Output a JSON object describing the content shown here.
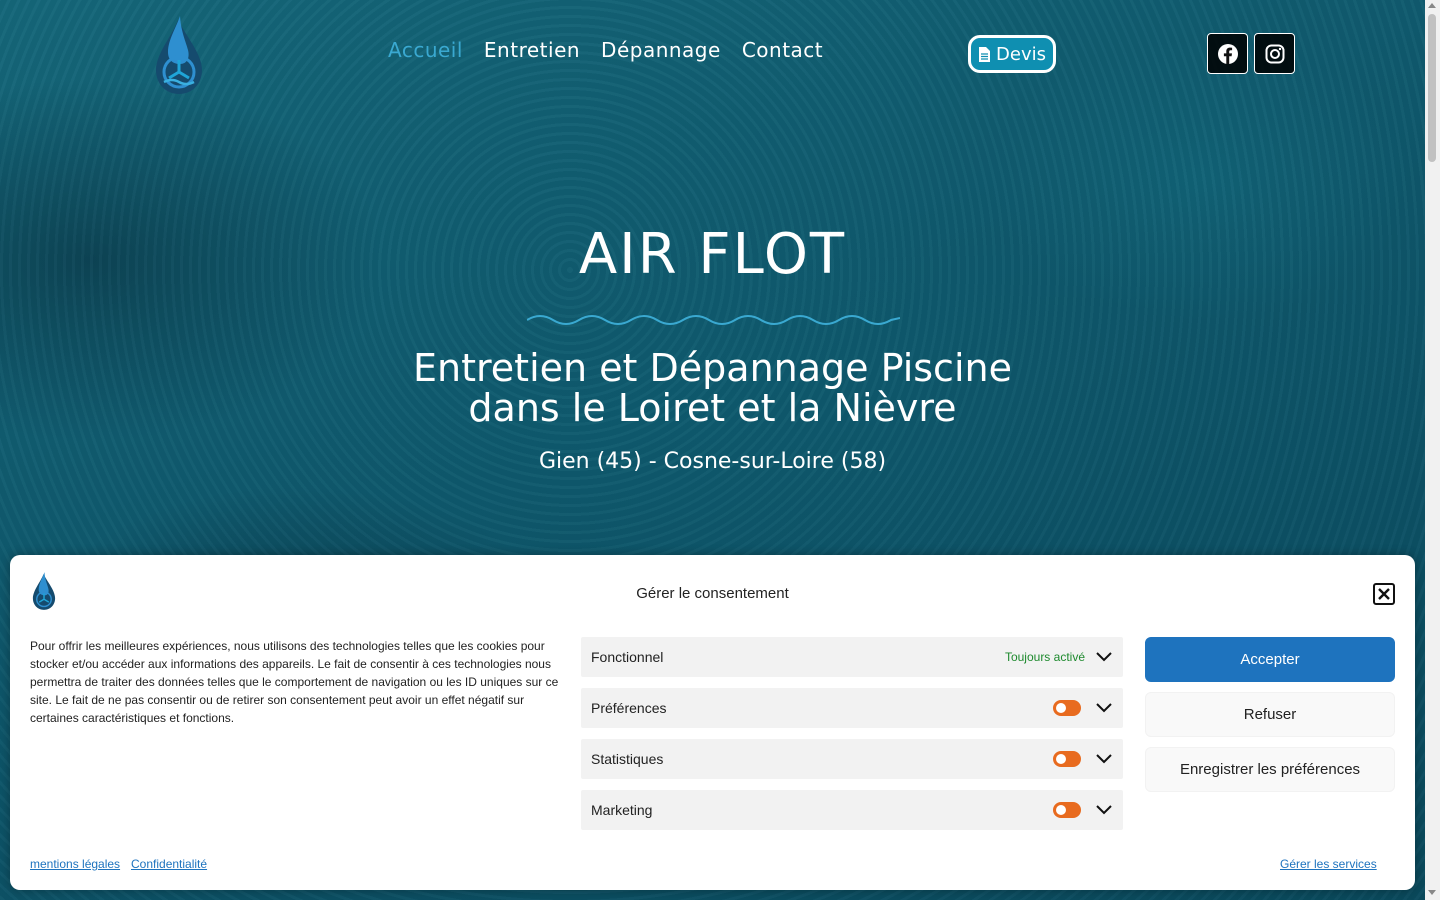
{
  "header": {
    "logo_icon": "air-flot-drop-logo",
    "nav": [
      "Accueil",
      "Entretien",
      "Dépannage",
      "Contact"
    ],
    "active_nav": "Accueil",
    "devis_label": "Devis",
    "social": [
      "facebook-icon",
      "instagram-icon"
    ]
  },
  "hero": {
    "title": "AIR FLOT",
    "subtitle_line1": "Entretien et Dépannage Piscine",
    "subtitle_line2": "dans le Loiret et la Nièvre",
    "location": "Gien (45) - Cosne-sur-Loire (58)"
  },
  "consent": {
    "title": "Gérer le consentement",
    "text": "Pour offrir les meilleures expériences, nous utilisons des technologies telles que les cookies pour stocker et/ou accéder aux informations des appareils. Le fait de consentir à ces technologies nous permettra de traiter des données telles que le comportement de navigation ou les ID uniques sur ce site. Le fait de ne pas consentir ou de retirer son consentement peut avoir un effet négatif sur certaines caractéristiques et fonctions.",
    "categories": [
      {
        "label": "Fonctionnel",
        "status": "Toujours activé"
      },
      {
        "label": "Préférences"
      },
      {
        "label": "Statistiques"
      },
      {
        "label": "Marketing"
      }
    ],
    "accept_label": "Accepter",
    "refuse_label": "Refuser",
    "save_label": "Enregistrer les préférences",
    "links": {
      "legal": "mentions légales",
      "privacy": "Confidentialité",
      "manage": "Gérer les services"
    }
  },
  "colors": {
    "accent": "#3aa9d1",
    "accept_button": "#1e73be",
    "toggle_off": "#e86b1f",
    "always_on": "#1e8a2e"
  }
}
